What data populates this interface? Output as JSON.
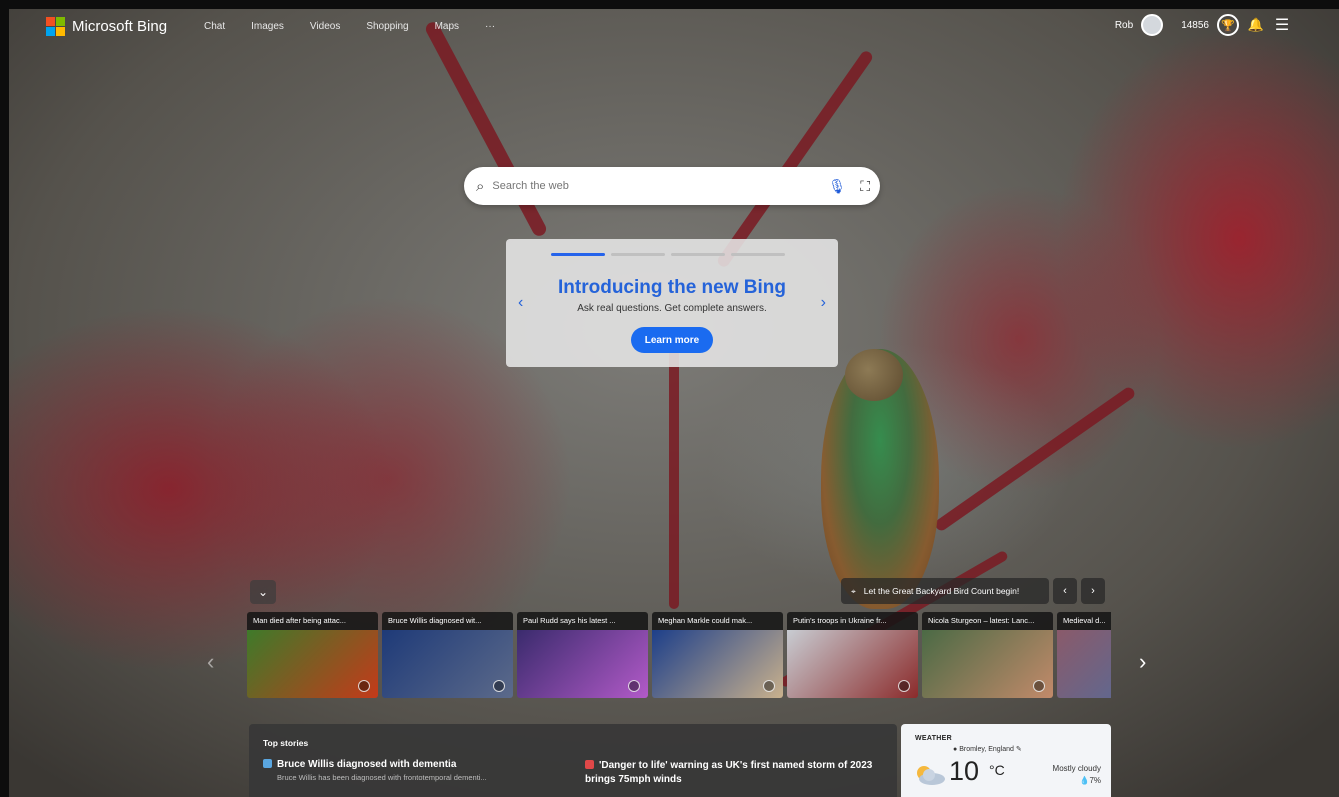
{
  "brand": {
    "name": "Microsoft Bing",
    "logo_colors": [
      "#f25022",
      "#7fba00",
      "#00a4ef",
      "#ffb900"
    ]
  },
  "nav": {
    "items": [
      {
        "label": "Chat"
      },
      {
        "label": "Images"
      },
      {
        "label": "Videos"
      },
      {
        "label": "Shopping"
      },
      {
        "label": "Maps"
      },
      {
        "label": "···"
      }
    ]
  },
  "account": {
    "name": "Rob",
    "points": "14856",
    "icons": [
      "avatar",
      "rewards-icon",
      "notifications-icon",
      "menu-icon"
    ]
  },
  "search": {
    "placeholder": "Search the web"
  },
  "promo": {
    "title": "Introducing the new Bing",
    "subtitle": "Ask real questions. Get complete answers.",
    "cta": "Learn more",
    "accent": "#2563d9"
  },
  "image_of_day": {
    "caption": "Let the Great Backyard Bird Count begin!"
  },
  "news_cards": [
    {
      "caption": "Man died after being attac...",
      "color_a": "#3e7a2a",
      "color_b": "#c43a1a"
    },
    {
      "caption": "Bruce Willis diagnosed wit...",
      "color_a": "#1e3a78",
      "color_b": "#5c6a8a"
    },
    {
      "caption": "Paul Rudd says his latest ...",
      "color_a": "#3a2b6d",
      "color_b": "#b25ac8"
    },
    {
      "caption": "Meghan Markle could mak...",
      "color_a": "#1d3f8a",
      "color_b": "#c9b18d"
    },
    {
      "caption": "Putin's troops in Ukraine fr...",
      "color_a": "#c8ccd2",
      "color_b": "#8b2b2b"
    },
    {
      "caption": "Nicola Sturgeon – latest: Lanc...",
      "color_a": "#4b6a45",
      "color_b": "#c28a6a"
    },
    {
      "caption": "Medieval d...",
      "color_a": "#8a5a6a",
      "color_b": "#4a6fa3"
    }
  ],
  "top_stories": {
    "heading": "Top stories",
    "items": [
      {
        "headline": "Bruce Willis diagnosed with dementia",
        "summary": "Bruce Willis has been diagnosed with frontotemporal dementi...",
        "mark_color": "#5aa6e0"
      },
      {
        "headline": "'Danger to life' warning as UK's first named storm of 2023 brings 75mph winds",
        "summary": "",
        "mark_color": "#e04848"
      }
    ]
  },
  "weather": {
    "label": "WEATHER",
    "location": "Bromley, England",
    "temp": "10",
    "unit": "°C",
    "condition": "Mostly cloudy",
    "precip": "7%"
  }
}
